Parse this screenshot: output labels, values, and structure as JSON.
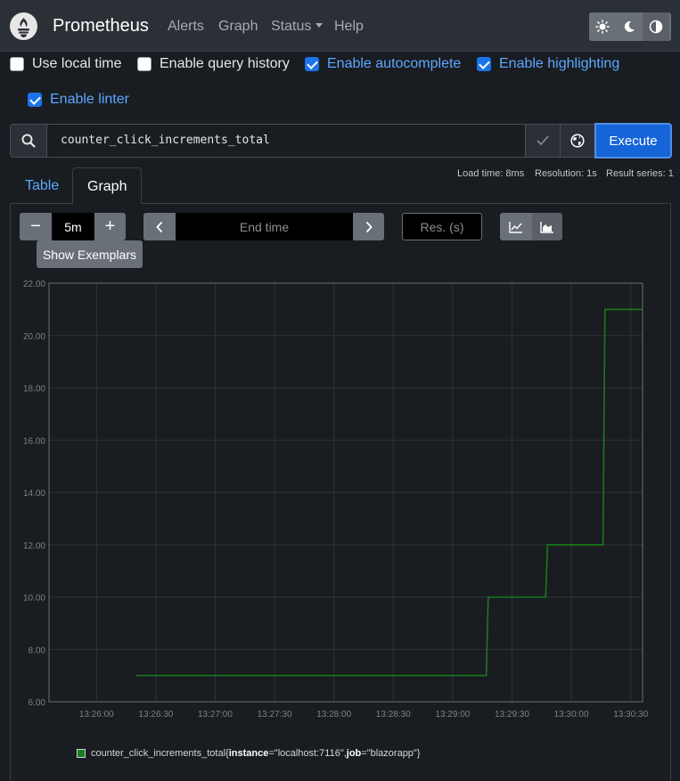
{
  "navbar": {
    "brand": "Prometheus",
    "links": {
      "alerts": "Alerts",
      "graph": "Graph",
      "status": "Status",
      "help": "Help"
    }
  },
  "options": {
    "local_time": {
      "label": "Use local time",
      "checked": false
    },
    "query_history": {
      "label": "Enable query history",
      "checked": false
    },
    "autocomplete": {
      "label": "Enable autocomplete",
      "checked": true
    },
    "highlighting": {
      "label": "Enable highlighting",
      "checked": true
    },
    "linter": {
      "label": "Enable linter",
      "checked": true
    }
  },
  "query": {
    "expression": "counter_click_increments_total",
    "execute_label": "Execute"
  },
  "stats": {
    "load_time": "Load time: 8ms",
    "resolution": "Resolution: 1s",
    "result_series": "Result series: 1"
  },
  "tabs": {
    "table": "Table",
    "graph": "Graph"
  },
  "graph_controls": {
    "range": "5m",
    "minus": "−",
    "plus": "+",
    "end_time_placeholder": "End time",
    "resolution_placeholder": "Res. (s)",
    "show_exemplars": "Show Exemplars"
  },
  "colors": {
    "background": "#191c21",
    "navbar": "#2b2f36",
    "accent": "#1565d8",
    "link_active": "#5da8ff",
    "series_line": "#1a7a1a"
  },
  "legend": {
    "metric": "counter_click_increments_total",
    "open_brace": "{",
    "instance_key": "instance",
    "instance_value": "=\"localhost:7116\", ",
    "job_key": "job",
    "job_value": "=\"blazorapp\"}"
  },
  "chart_data": {
    "type": "line",
    "title": "",
    "xlabel": "",
    "ylabel": "",
    "ylim": [
      6,
      22
    ],
    "xlim": [
      "13:25:36",
      "13:30:36"
    ],
    "yticks": [
      "6.00",
      "8.00",
      "10.00",
      "12.00",
      "14.00",
      "16.00",
      "18.00",
      "20.00",
      "22.00"
    ],
    "xticks": [
      "13:26:00",
      "13:26:30",
      "13:27:00",
      "13:27:30",
      "13:28:00",
      "13:28:30",
      "13:29:00",
      "13:29:30",
      "13:30:00",
      "13:30:30"
    ],
    "grid": true,
    "legend_position": "bottom",
    "series": [
      {
        "name": "counter_click_increments_total{instance=\"localhost:7116\", job=\"blazorapp\"}",
        "color": "#1a7a1a",
        "step": true,
        "points": [
          [
            "13:26:20",
            7
          ],
          [
            "13:29:17",
            7
          ],
          [
            "13:29:18",
            10
          ],
          [
            "13:29:47",
            10
          ],
          [
            "13:29:48",
            12
          ],
          [
            "13:30:16",
            12
          ],
          [
            "13:30:17",
            21
          ],
          [
            "13:30:36",
            21
          ]
        ]
      }
    ]
  }
}
